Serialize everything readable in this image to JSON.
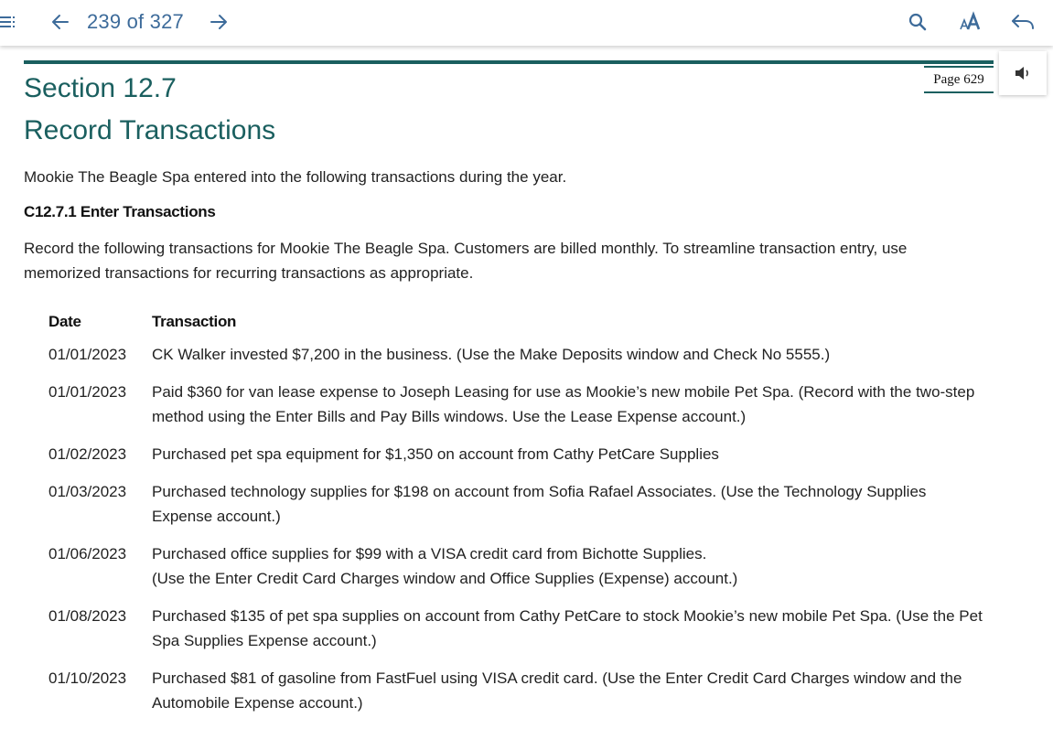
{
  "toolbar": {
    "page_counter": "239 of 327",
    "icons": {
      "menu": "menu-icon",
      "back": "arrow-left-icon",
      "forward": "arrow-right-icon",
      "search": "search-icon",
      "font": "font-size-icon",
      "return": "return-icon",
      "audio": "speaker-icon"
    },
    "accent_color": "#3d6b9a"
  },
  "page": {
    "page_label": "Page 629",
    "section_number": "Section 12.7",
    "section_title": "Record Transactions",
    "intro": "Mookie The Beagle Spa entered into the following transactions during the year.",
    "subheading": "C12.7.1 Enter Transactions",
    "instructions": "Record the following transactions for Mookie The Beagle Spa. Customers are billed monthly. To streamline transaction entry, use memorized transactions for recurring transactions as appropriate.",
    "heading_color": "#1a5f5f"
  },
  "table": {
    "headers": {
      "date": "Date",
      "transaction": "Transaction"
    },
    "rows": [
      {
        "date": "01/01/2023",
        "transaction": "CK Walker invested $7,200 in the business. (Use the Make Deposits window and Check No 5555.)"
      },
      {
        "date": "01/01/2023",
        "transaction": "Paid $360 for van lease expense to Joseph Leasing for use as Mookie’s new mobile Pet Spa. (Record with the two-step method using the Enter Bills and Pay Bills windows. Use the Lease Expense account.)"
      },
      {
        "date": "01/02/2023",
        "transaction": "Purchased pet spa equipment for $1,350 on account from Cathy PetCare Supplies"
      },
      {
        "date": "01/03/2023",
        "transaction": "Purchased technology supplies for $198 on account from Sofia Rafael Associates. (Use the Technology Supplies Expense account.)"
      },
      {
        "date": "01/06/2023",
        "transaction": "Purchased office supplies for $99 with a VISA credit card from Bichotte Supplies.\n(Use the Enter Credit Card Charges window and Office Supplies (Expense) account.)"
      },
      {
        "date": "01/08/2023",
        "transaction": "Purchased $135 of pet spa supplies on account from Cathy PetCare to stock Mookie’s new mobile Pet Spa. (Use the Pet Spa Supplies Expense account.)"
      },
      {
        "date": "01/10/2023",
        "transaction": "Purchased $81 of gasoline from FastFuel using VISA credit card. (Use the Enter Credit Card Charges window and the Automobile Expense account.)"
      }
    ]
  }
}
